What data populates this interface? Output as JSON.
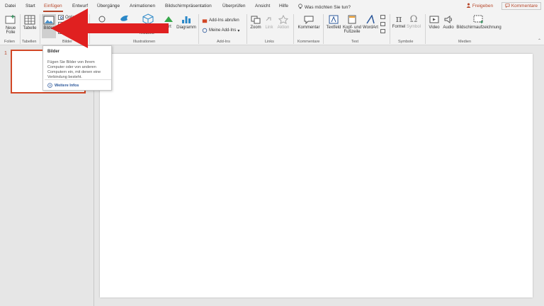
{
  "menu": {
    "tabs": [
      "Datei",
      "Start",
      "Einfügen",
      "Entwurf",
      "Übergänge",
      "Animationen",
      "Bildschirmpräsentation",
      "Überprüfen",
      "Ansicht",
      "Hilfe"
    ],
    "active_tab": "Einfügen",
    "tell_me": "Was möchten Sie tun?",
    "share": "Freigeben",
    "comments": "Kommentare"
  },
  "ribbon": {
    "new_slide_1": "Neue",
    "new_slide_2": "Folie",
    "table": "Tabelle",
    "pictures": "Bilder",
    "online_pictures": "Onlinebilder",
    "models_3d": "Modelle",
    "smartart": "Art",
    "chart": "Diagramm",
    "get_addins": "Add-Ins abrufen",
    "my_addins": "Meine Add-Ins",
    "zoom": "Zoom",
    "link": "Link",
    "action": "Aktion",
    "comment": "Kommentar",
    "textbox": "Textfeld",
    "header_footer_1": "Kopf- und",
    "header_footer_2": "Fußzeile",
    "wordart": "WordArt",
    "equation": "Formel",
    "symbol": "Symbol",
    "video": "Video",
    "audio": "Audio",
    "screen_recording": "Bildschirmaufzeichnung",
    "groups": {
      "slides": "Folien",
      "tables": "Tabellen",
      "images": "Bilder",
      "illustrations": "Illustrationen",
      "addins": "Add-Ins",
      "links": "Links",
      "comments": "Kommentare",
      "text": "Text",
      "symbols": "Symbole",
      "media": "Medien"
    }
  },
  "tooltip": {
    "title": "Bilder",
    "body": "Fügen Sie Bilder von Ihrem Computer oder von anderen Computern ein, mit denen eine Verbindung besteht.",
    "link": "Weitere Infos"
  },
  "slides_panel": {
    "slide_number": "1"
  },
  "colors": {
    "accent": "#b7472a",
    "arrow": "#e02020",
    "link": "#2b579a"
  }
}
